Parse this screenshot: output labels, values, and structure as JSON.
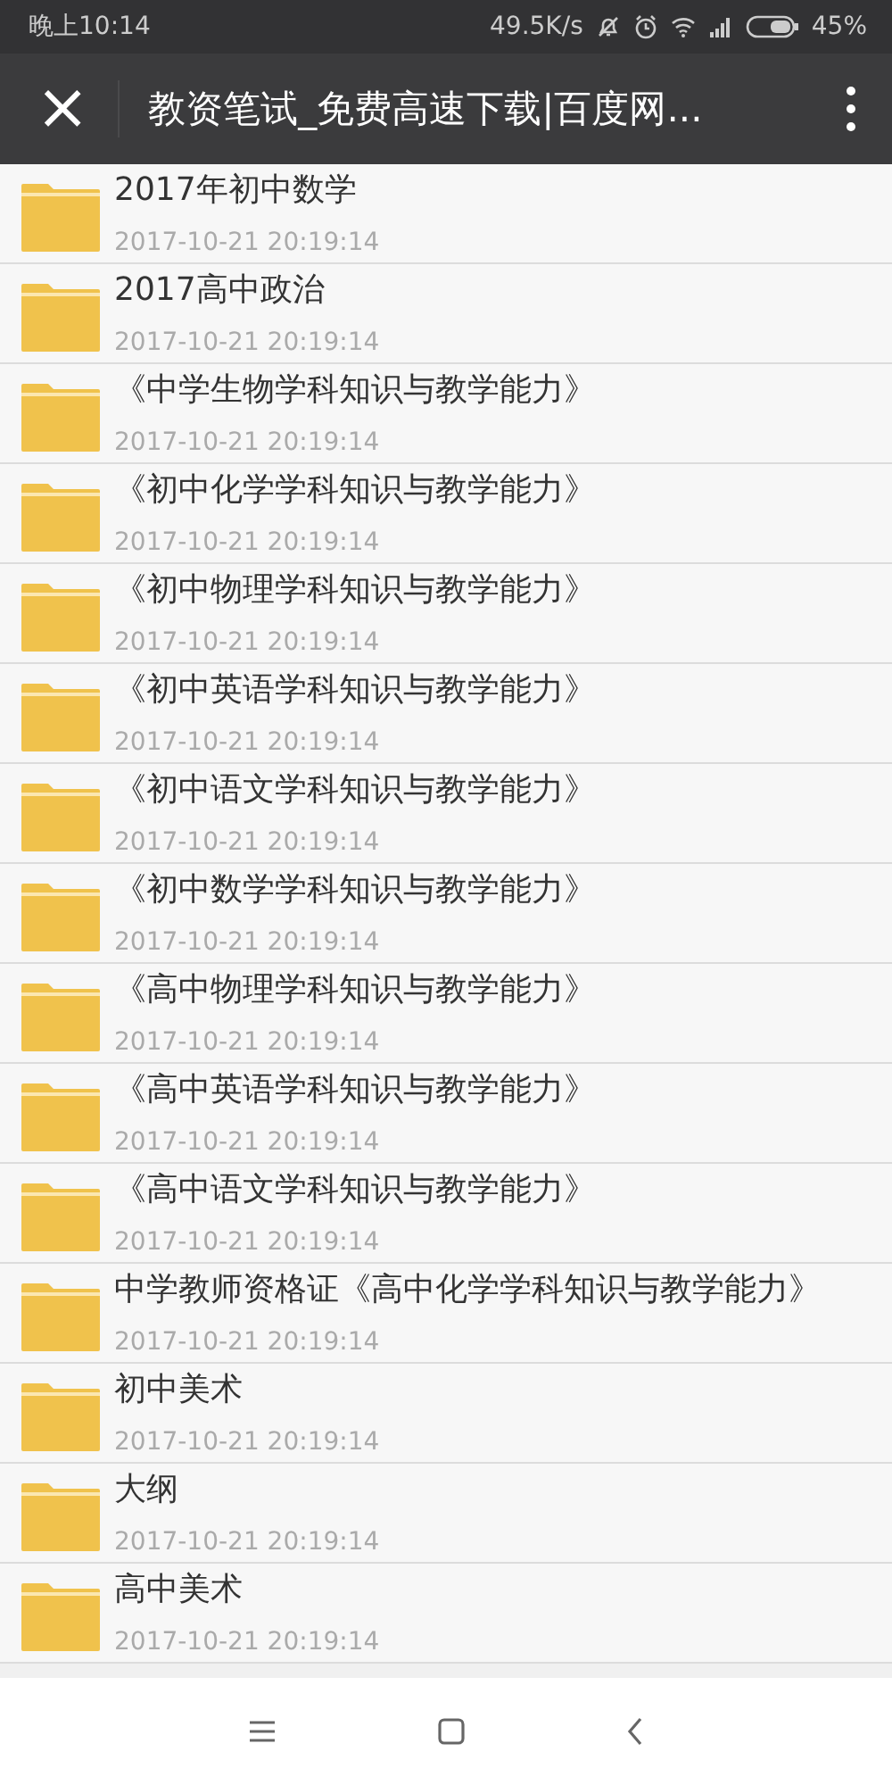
{
  "status_bar": {
    "time": "晚上10:14",
    "speed": "49.5K/s",
    "battery": "45%"
  },
  "toolbar": {
    "close": "×",
    "title": "教资笔试_免费高速下载|百度网..."
  },
  "files": [
    {
      "name": "2017年初中数学",
      "date": "2017-10-21 20:19:14"
    },
    {
      "name": "2017高中政治",
      "date": "2017-10-21 20:19:14"
    },
    {
      "name": "《中学生物学科知识与教学能力》",
      "date": "2017-10-21 20:19:14"
    },
    {
      "name": "《初中化学学科知识与教学能力》",
      "date": "2017-10-21 20:19:14"
    },
    {
      "name": "《初中物理学科知识与教学能力》",
      "date": "2017-10-21 20:19:14"
    },
    {
      "name": "《初中英语学科知识与教学能力》",
      "date": "2017-10-21 20:19:14"
    },
    {
      "name": "《初中语文学科知识与教学能力》",
      "date": "2017-10-21 20:19:14"
    },
    {
      "name": "《初中数学学科知识与教学能力》",
      "date": "2017-10-21 20:19:14"
    },
    {
      "name": "《高中物理学科知识与教学能力》",
      "date": "2017-10-21 20:19:14"
    },
    {
      "name": "《高中英语学科知识与教学能力》",
      "date": "2017-10-21 20:19:14"
    },
    {
      "name": "《高中语文学科知识与教学能力》",
      "date": "2017-10-21 20:19:14"
    },
    {
      "name": "中学教师资格证《高中化学学科知识与教学能力》",
      "date": "2017-10-21 20:19:14"
    },
    {
      "name": "初中美术",
      "date": "2017-10-21 20:19:14"
    },
    {
      "name": "大纲",
      "date": "2017-10-21 20:19:14"
    },
    {
      "name": "高中美术",
      "date": "2017-10-21 20:19:14"
    }
  ]
}
